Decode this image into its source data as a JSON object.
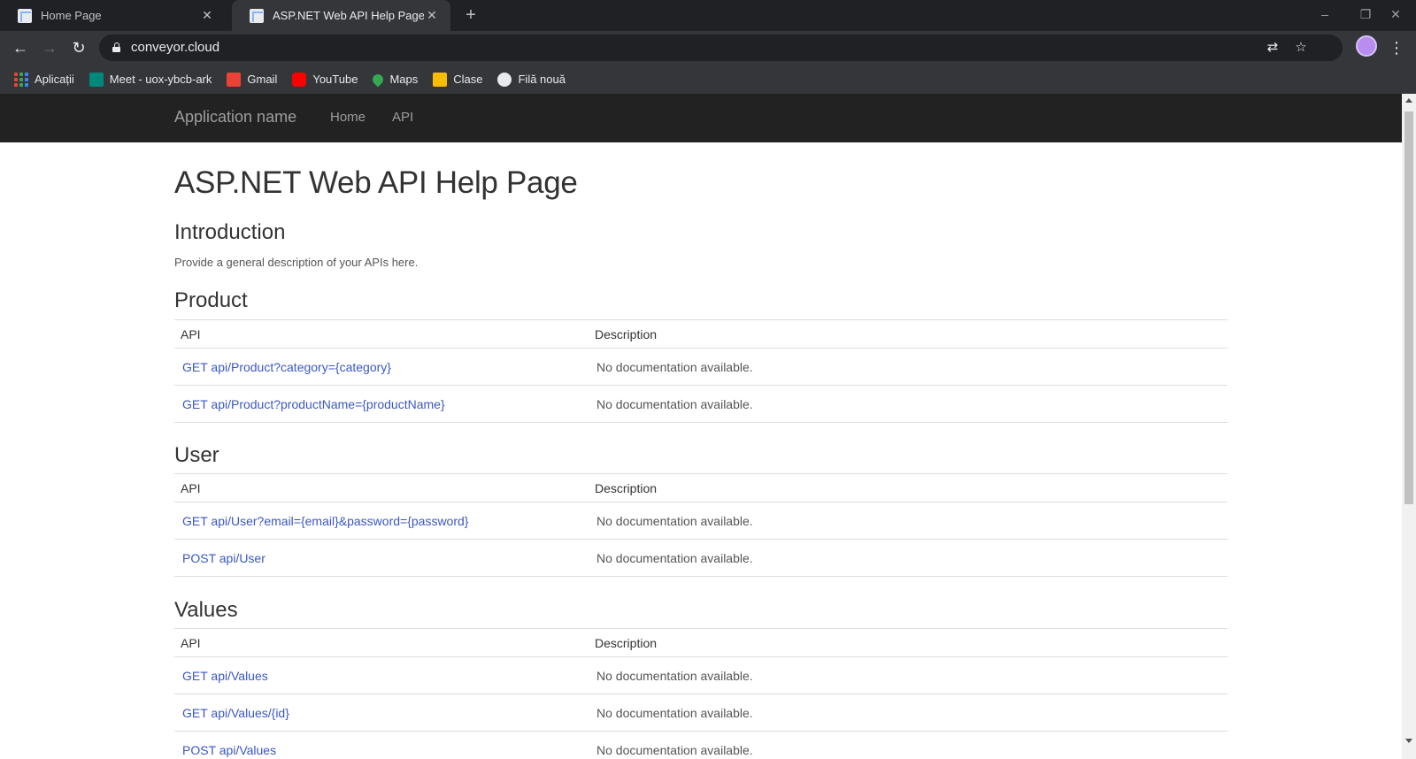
{
  "browser": {
    "tabs": [
      {
        "title": "Home Page",
        "active": false
      },
      {
        "title": "ASP.NET Web API Help Page",
        "active": true
      }
    ],
    "new_tab_icon": "plus-icon",
    "window_controls": {
      "minimize": "–",
      "restore": "❐",
      "close": "✕"
    },
    "url": "conveyor.cloud",
    "bookmarks": [
      {
        "label": "Aplicații",
        "icon": "apps-grid-icon"
      },
      {
        "label": "Meet - uox-ybcb-ark",
        "icon": "meet-icon",
        "color": "#00897b"
      },
      {
        "label": "Gmail",
        "icon": "gmail-icon",
        "color": "#ea4335"
      },
      {
        "label": "YouTube",
        "icon": "youtube-icon",
        "color": "#ff0000"
      },
      {
        "label": "Maps",
        "icon": "maps-icon",
        "color": "#34a853"
      },
      {
        "label": "Clase",
        "icon": "classroom-icon",
        "color": "#fbbc04"
      },
      {
        "label": "Filă nouă",
        "icon": "globe-icon",
        "color": "#e8eaed"
      }
    ]
  },
  "site": {
    "brand": "Application name",
    "nav": [
      "Home",
      "API"
    ]
  },
  "page": {
    "title": "ASP.NET Web API Help Page",
    "intro_heading": "Introduction",
    "intro_text": "Provide a general description of your APIs here.",
    "columns": {
      "api": "API",
      "description": "Description"
    },
    "sections": [
      {
        "name": "Product",
        "rows": [
          {
            "api": "GET api/Product?category={category}",
            "description": "No documentation available."
          },
          {
            "api": "GET api/Product?productName={productName}",
            "description": "No documentation available."
          }
        ]
      },
      {
        "name": "User",
        "rows": [
          {
            "api": "GET api/User?email={email}&password={password}",
            "description": "No documentation available."
          },
          {
            "api": "POST api/User",
            "description": "No documentation available."
          }
        ]
      },
      {
        "name": "Values",
        "rows": [
          {
            "api": "GET api/Values",
            "description": "No documentation available."
          },
          {
            "api": "GET api/Values/{id}",
            "description": "No documentation available."
          },
          {
            "api": "POST api/Values",
            "description": "No documentation available."
          }
        ]
      }
    ]
  },
  "colors": {
    "link": "#3b57c4",
    "navbar": "#222222",
    "chrome_dark": "#202124",
    "chrome_toolbar": "#35363a"
  }
}
